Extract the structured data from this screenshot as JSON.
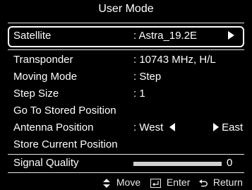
{
  "menu": {
    "title": "User Mode",
    "selected": {
      "label": "Satellite",
      "value": ": Astra_19.2E"
    },
    "items": [
      {
        "label": "Transponder",
        "value": ": 10743 MHz, H/L"
      },
      {
        "label": "Moving Mode",
        "value": ": Step"
      },
      {
        "label": "Step Size",
        "value": ": 1"
      },
      {
        "label": "Go To Stored Position",
        "value": ""
      },
      {
        "label": "Antenna Position",
        "value": ": West",
        "value_right": "East"
      },
      {
        "label": "Store Current Position",
        "value": ""
      }
    ],
    "signal": {
      "label": "Signal Quality",
      "value": "0"
    }
  },
  "footer": {
    "move": "Move",
    "enter": "Enter",
    "return": "Return"
  },
  "icons": [
    "right-arrow-icon",
    "left-arrow-icon",
    "right-arrow-icon",
    "up-down-icon",
    "enter-icon",
    "return-icon"
  ]
}
